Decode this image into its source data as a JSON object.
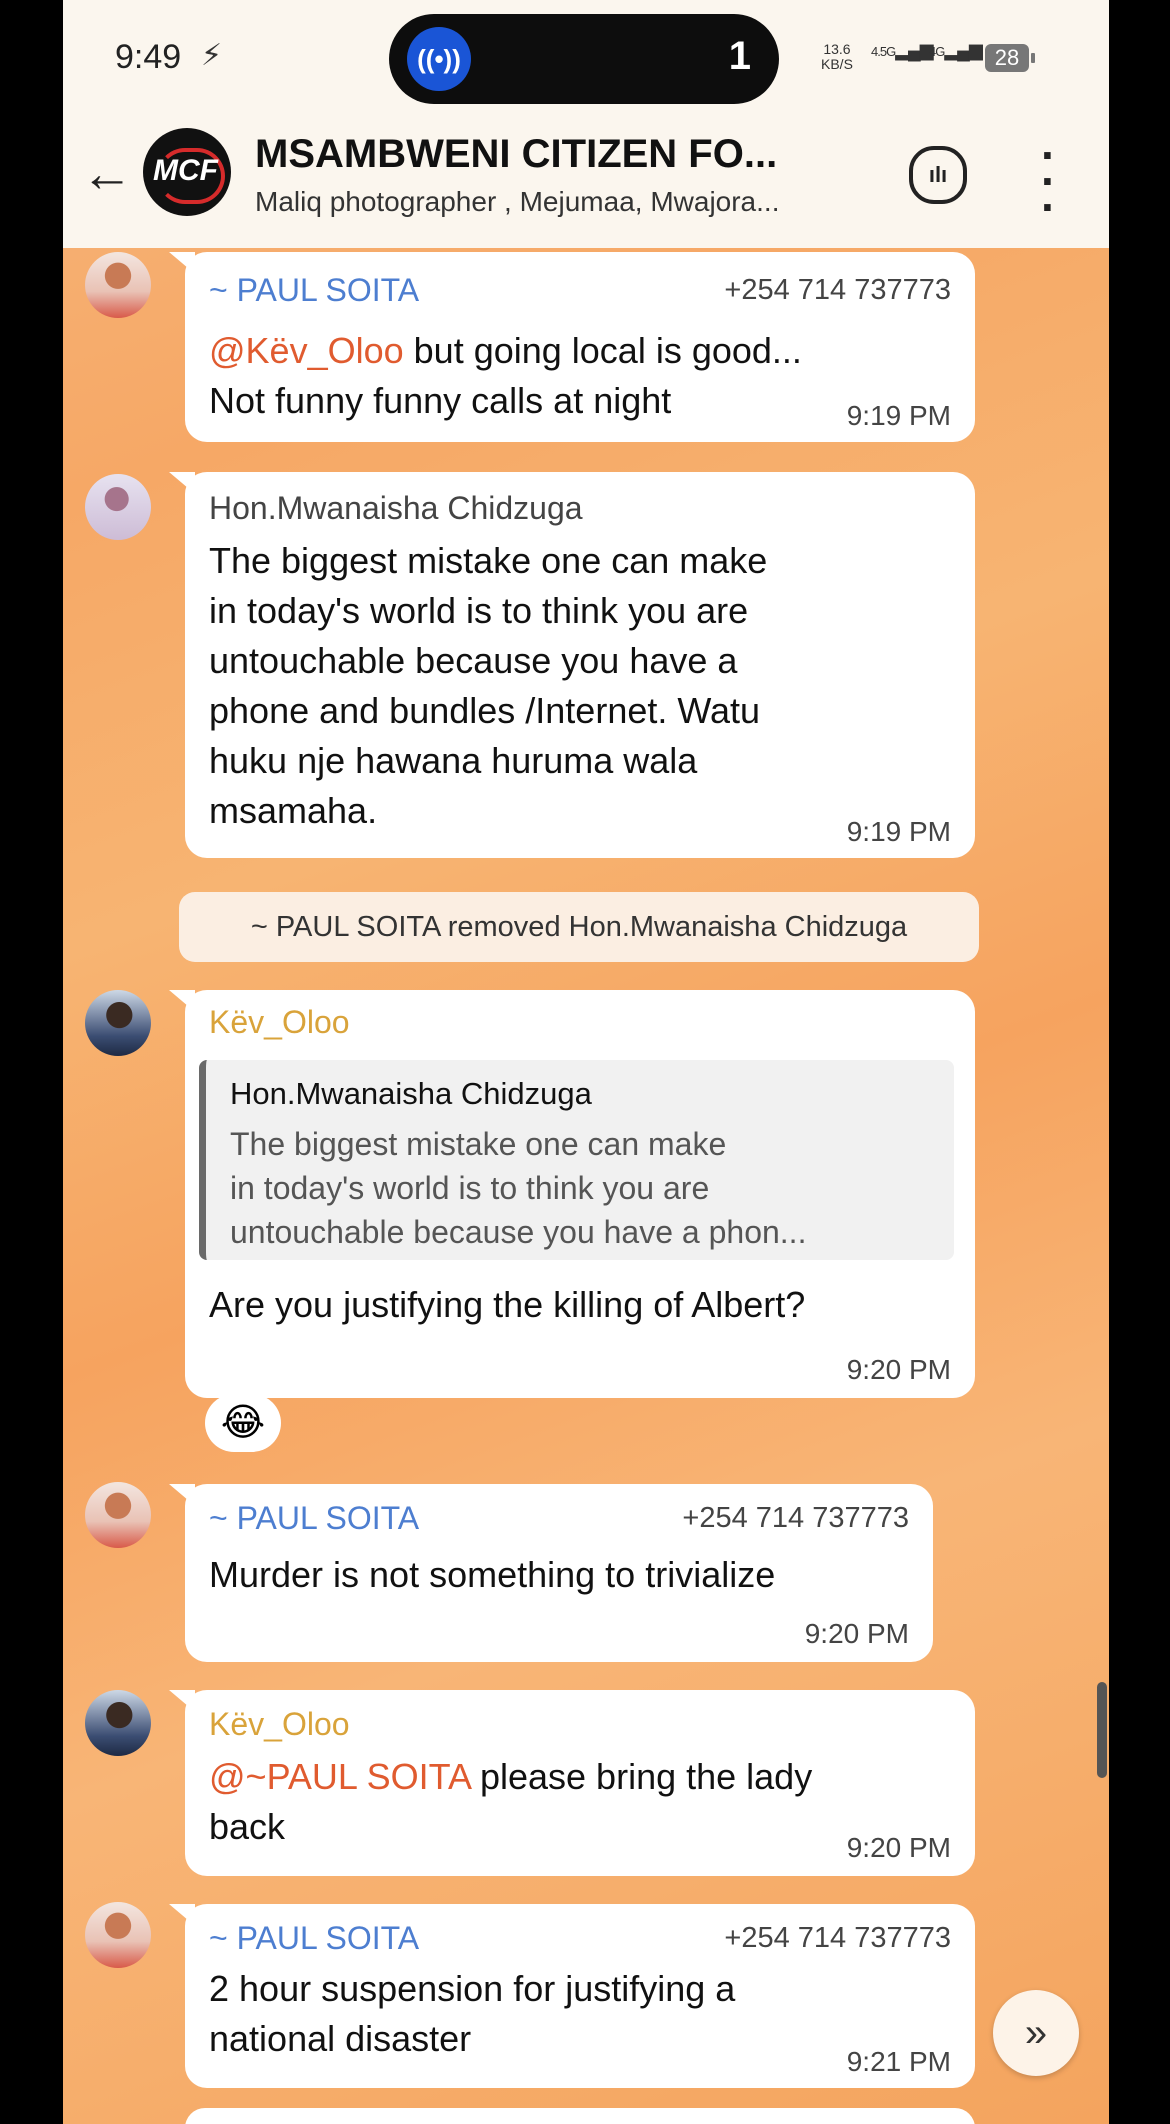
{
  "status_bar": {
    "time": "9:49",
    "island_count": "1",
    "net_speed_value": "13.6",
    "net_speed_unit": "KB/S",
    "signal1_label": "4.5G",
    "signal2_label": "4G",
    "battery": "28"
  },
  "header": {
    "avatar_text": "MCF",
    "title": "MSAMBWENI CITIZEN FO...",
    "subtitle": "Maliq photographer , Mejumaa, Mwajora..."
  },
  "messages": [
    {
      "sender": "~ PAUL SOITA",
      "phone": "+254 714 737773",
      "mention": "@Këv_Oloo",
      "line1_rest": " but going local is good...",
      "line2": "Not funny funny calls at night",
      "time": "9:19 PM"
    },
    {
      "sender": "Hon.Mwanaisha Chidzuga",
      "lines": [
        "The biggest mistake  one can make",
        "in today's world   is to think  you are",
        "untouchable  because you have  a",
        "phone  and bundles /Internet. Watu",
        "huku nje hawana huruma wala",
        "msamaha."
      ],
      "time": "9:19 PM"
    },
    {
      "sender": "Këv_Oloo",
      "quote_sender": "Hon.Mwanaisha Chidzuga",
      "quote_lines": [
        "The biggest mistake  one can make",
        "in today's world   is to think  you are",
        "untouchable  because you have  a phon..."
      ],
      "text": "Are you justifying the killing of Albert?",
      "time": "9:20 PM",
      "reaction": "😂"
    },
    {
      "sender": "~ PAUL SOITA",
      "phone": "+254 714 737773",
      "text": "Murder is not something to trivialize",
      "time": "9:20 PM"
    },
    {
      "sender": "Këv_Oloo",
      "mention": "@~PAUL SOITA",
      "line1_rest": " please bring the lady",
      "line2": "back",
      "time": "9:20 PM"
    },
    {
      "sender": "~ PAUL SOITA",
      "phone": "+254 714 737773",
      "line1": "2 hour suspension for justifying a",
      "line2": "national disaster",
      "time": "9:21 PM"
    }
  ],
  "system_message": "~ PAUL SOITA removed Hon.Mwanaisha Chidzuga",
  "colors": {
    "paul_name": "#4d7ed0",
    "mwanaisha_name": "#444444",
    "kev_name": "#d9a33a",
    "mention": "#e05b2f",
    "wallpaper": "#f6a866"
  }
}
